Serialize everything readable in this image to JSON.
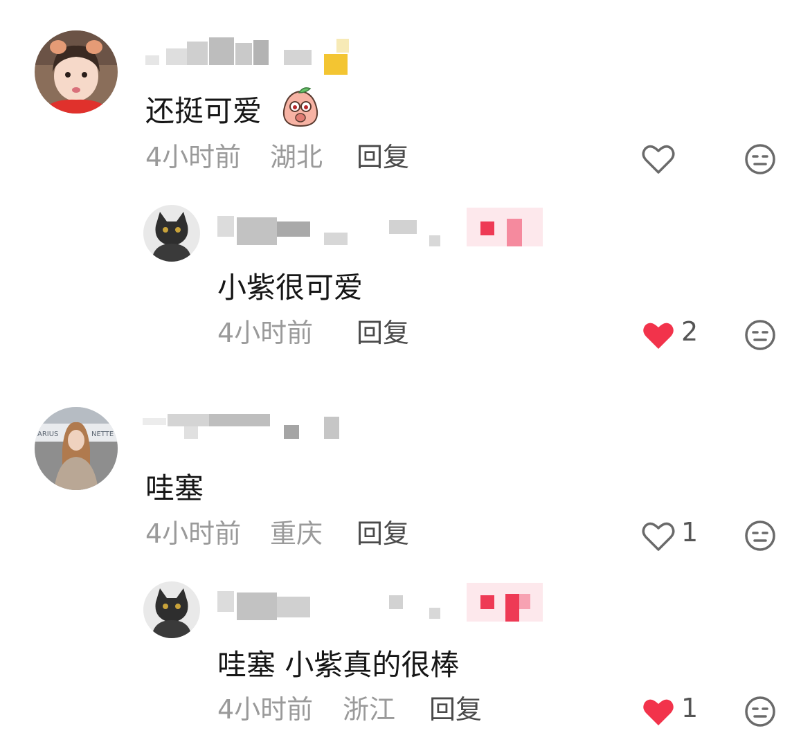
{
  "comments": [
    {
      "text": "还挺可爱",
      "time": "4小时前",
      "location": "湖北",
      "reply_label": "回复",
      "likes": "",
      "liked": false,
      "replies": [
        {
          "text": "小紫很可爱",
          "time": "4小时前",
          "location": "",
          "reply_label": "回复",
          "likes": "2",
          "liked": true
        }
      ]
    },
    {
      "text": "哇塞",
      "time": "4小时前",
      "location": "重庆",
      "reply_label": "回复",
      "likes": "1",
      "liked": false,
      "replies": [
        {
          "text": "哇塞 小紫真的很棒",
          "time": "4小时前",
          "location": "浙江",
          "reply_label": "回复",
          "likes": "1",
          "liked": true
        }
      ]
    }
  ],
  "icons": {
    "like": "heart-outline-icon",
    "liked": "heart-filled-icon",
    "dislike": "meh-face-icon",
    "emoji": "peach-emoji-icon"
  },
  "colors": {
    "liked_red": "#f2334b",
    "meta_gray": "#9a9a9a",
    "text": "#161616"
  }
}
